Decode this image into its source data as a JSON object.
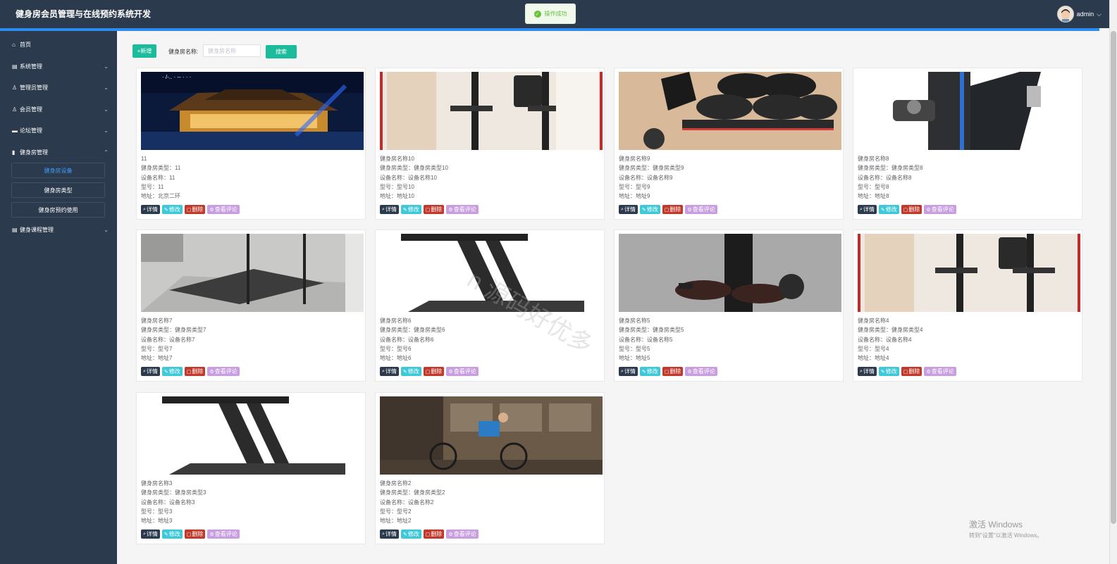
{
  "header": {
    "title": "健身房会员管理与在线预约系统开发",
    "username": "admin",
    "user_chevron": "⌵"
  },
  "toast": {
    "message": "操作成功"
  },
  "sidebar": {
    "items": [
      {
        "label": "首页",
        "icon": "home-icon",
        "glyph": "⌂",
        "has_chevron": false
      },
      {
        "label": "系统管理",
        "icon": "system-icon",
        "glyph": "▤",
        "has_chevron": true,
        "chevron": "⌄"
      },
      {
        "label": "管理员管理",
        "icon": "user-icon",
        "glyph": "♙",
        "has_chevron": true,
        "chevron": "⌄"
      },
      {
        "label": "会员管理",
        "icon": "member-icon",
        "glyph": "♙",
        "has_chevron": true,
        "chevron": "⌄"
      },
      {
        "label": "论坛管理",
        "icon": "forum-icon",
        "glyph": "▬",
        "has_chevron": true,
        "chevron": "⌄"
      },
      {
        "label": "健身房管理",
        "icon": "gym-icon",
        "glyph": "▮",
        "has_chevron": true,
        "chevron": "⌃"
      },
      {
        "label": "健身课程管理",
        "icon": "course-icon",
        "glyph": "▤",
        "has_chevron": true,
        "chevron": "⌄"
      }
    ],
    "subitems": [
      {
        "label": "健身房设备",
        "active": true
      },
      {
        "label": "健身房类型",
        "active": false
      },
      {
        "label": "健身房预约使用",
        "active": false
      }
    ]
  },
  "toolbar": {
    "add_label": "+新增",
    "search_label": "健身房名称:",
    "search_placeholder": "健身房名称",
    "search_button": "搜索"
  },
  "actions": {
    "detail": "详情",
    "edit": "修改",
    "delete": "删除",
    "comment": "查看评论"
  },
  "cards": [
    {
      "name": "11",
      "lines": [
        "11",
        "健身房类型：11",
        "设备名称：11",
        "型号：11",
        "地址：北京二环"
      ],
      "image": "night-palace-photo"
    },
    {
      "name": "健身房名称10",
      "lines": [
        "健身房名称10",
        "健身房类型：健身房类型10",
        "设备名称：设备名称10",
        "型号：型号10",
        "地址：地址10"
      ],
      "image": "pullup-station-photo"
    },
    {
      "name": "健身房名称9",
      "lines": [
        "健身房名称9",
        "健身房类型：健身房类型9",
        "设备名称：设备名称9",
        "型号：型号9",
        "地址：地址9"
      ],
      "image": "bench-tires-photo"
    },
    {
      "name": "健身房名称8",
      "lines": [
        "健身房名称8",
        "健身房类型：健身房类型8",
        "设备名称：设备名称8",
        "型号：型号8",
        "地址：地址8"
      ],
      "image": "leg-machine-photo"
    },
    {
      "name": "健身房名称7",
      "lines": [
        "健身房名称7",
        "健身房类型：健身房类型7",
        "设备名称：设备名称7",
        "型号：型号7",
        "地址：地址7"
      ],
      "image": "treadmill-gray-photo"
    },
    {
      "name": "健身房名称6",
      "lines": [
        "健身房名称6",
        "健身房类型：健身房类型6",
        "设备名称：设备名称6",
        "型号：型号6",
        "地址：地址6"
      ],
      "image": "treadmill-black-photo"
    },
    {
      "name": "健身房名称5",
      "lines": [
        "健身房名称5",
        "健身房类型：健身房类型5",
        "设备名称：设备名称5",
        "型号：型号5",
        "地址：地址5"
      ],
      "image": "leg-extension-photo"
    },
    {
      "name": "健身房名称4",
      "lines": [
        "健身房名称4",
        "健身房类型：健身房类型4",
        "设备名称：设备名称4",
        "型号：型号4",
        "地址：地址4"
      ],
      "image": "pullup-station-photo-2"
    },
    {
      "name": "健身房名称3",
      "lines": [
        "健身房名称3",
        "健身房类型：健身房类型3",
        "设备名称：设备名称3",
        "型号：型号3",
        "地址：地址3"
      ],
      "image": "treadmill-black-photo-2"
    },
    {
      "name": "健身房名称2",
      "lines": [
        "健身房名称2",
        "健身房类型：健身房类型2",
        "设备名称：设备名称2",
        "型号：型号2",
        "地址：地址2"
      ],
      "image": "cyclist-photo"
    }
  ],
  "watermark": "n 源码好优多",
  "windows_activation": {
    "line1": "激活 Windows",
    "line2": "转到\"设置\"以激活 Windows。"
  },
  "colors": {
    "header_bg": "#2b3a4d",
    "accent_blue": "#2d8cf0",
    "primary_green": "#1abc9c",
    "detail_btn": "#2b3a4d",
    "edit_btn": "#3fc9d8",
    "delete_btn": "#c0392b",
    "comment_btn": "#c89ee0"
  }
}
